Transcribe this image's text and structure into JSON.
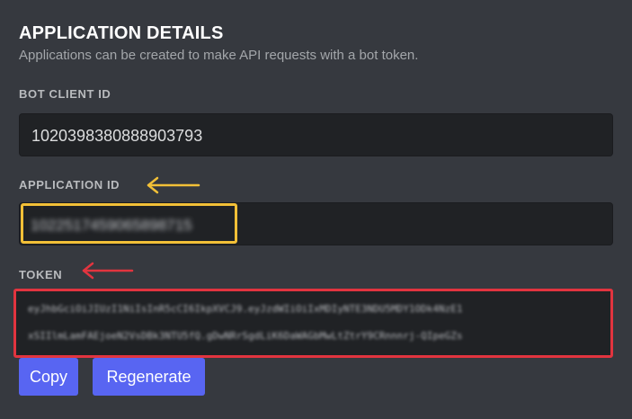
{
  "section": {
    "title": "APPLICATION DETAILS",
    "description": "Applications can be created to make API requests with a bot token."
  },
  "bot_client_id": {
    "label": "BOT CLIENT ID",
    "value": "1020398380888903793"
  },
  "application_id": {
    "label": "APPLICATION ID",
    "value": "1022517459065898715"
  },
  "token": {
    "label": "TOKEN",
    "line1": "eyJhbGciOiJIUzI1NiIsInR5cCI6IkpXVCJ9.eyJzdWIiOiIxMDIyNTE3NDU5MDY1ODk4NzE1",
    "line2": "xSIIlmLamFAEjoeN2VsDBk3NTU5fQ.gDwNRrSgdLiK6DaWAGbMwLtZtrY9CRnnnrj-QIpeGZs"
  },
  "buttons": {
    "copy": "Copy",
    "regenerate": "Regenerate"
  },
  "colors": {
    "background": "#36393f",
    "input_background": "#202225",
    "button": "#5865f2",
    "yellow_annotation": "#f2c037",
    "red_annotation": "#e2343f"
  }
}
